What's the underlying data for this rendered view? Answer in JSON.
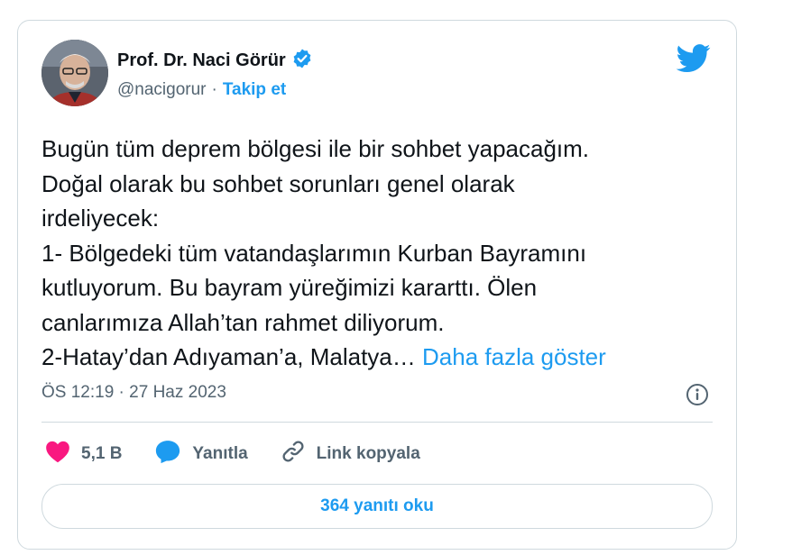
{
  "author": {
    "name": "Prof. Dr. Naci Görür",
    "handle": "@nacigorur",
    "separator": "·",
    "follow_label": "Takip et"
  },
  "tweet": {
    "lines": "Bugün tüm deprem bölgesi ile bir sohbet yapacağım.\nDoğal olarak bu sohbet sorunları genel olarak\nirdeliyecek:\n1- Bölgedeki tüm vatandaşlarımın Kurban Bayramını\nkutluyorum. Bu bayram yüreğimizi kararttı. Ölen\ncanlarımıza Allah’tan rahmet diliyorum.\n2-Hatay’dan Adıyaman’a, Malatya…",
    "show_more": "Daha fazla göster"
  },
  "meta": {
    "timestamp": "ÖS 12:19 · 27 Haz 2023"
  },
  "actions": {
    "likes": "5,1 B",
    "reply_label": "Yanıtla",
    "copy_link_label": "Link kopyala"
  },
  "replies_button": "364 yanıtı oku",
  "colors": {
    "accent": "#1d9bf0",
    "like": "#f91880",
    "muted": "#536471",
    "border": "#cfd9de"
  },
  "icons": [
    "verified-badge-icon",
    "twitter-bird-icon",
    "info-icon",
    "heart-icon",
    "reply-bubble-icon",
    "link-icon"
  ]
}
